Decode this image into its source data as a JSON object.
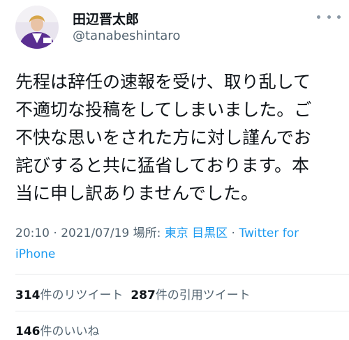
{
  "user": {
    "display_name": "田辺晋太郎",
    "handle": "@tanabeshintaro"
  },
  "tweet": {
    "lines": [
      "先程は辞任の速報を受け、取り乱して",
      "不適切な投稿をしてしまいました。ご",
      "不快な思いをされた方に対し謹んでお",
      "詫びすると共に猛省しております。本",
      "当に申し訳ありませんでした。"
    ]
  },
  "meta": {
    "time": "20:10",
    "sep1": " · ",
    "date": "2021/07/19",
    "location_label": " 場所: ",
    "location": "東京 目黒区",
    "sep2": " · ",
    "client_part1": "Twitter for",
    "client_part2": "iPhone"
  },
  "stats": {
    "retweets_count": "314",
    "retweets_label": "件のリツイート",
    "quotes_count": "287",
    "quotes_label": "件の引用ツイート",
    "likes_count": "146",
    "likes_label": "件のいいね"
  },
  "colors": {
    "link": "#1d9bf0",
    "secondary_text": "#536471",
    "avatar_jacket": "#5a2e91"
  },
  "icons": {
    "more": "more-dots-icon"
  }
}
